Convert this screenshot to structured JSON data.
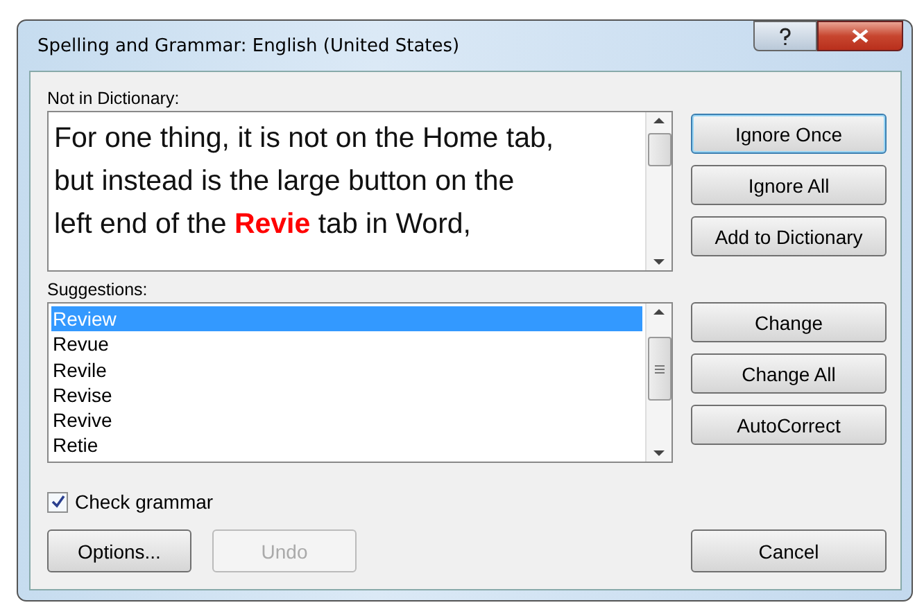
{
  "window": {
    "title": "Spelling and Grammar: English (United States)"
  },
  "not_in_dictionary": {
    "label": "Not in Dictionary:",
    "lines": [
      "For one thing, it is not on the Home tab,",
      "but instead is the large button on the",
      "left end of the **Revie** tab in Word,"
    ]
  },
  "suggestions": {
    "label": "Suggestions:",
    "items": [
      {
        "text": "Review",
        "selected": true
      },
      {
        "text": "Revue",
        "selected": false
      },
      {
        "text": "Revile",
        "selected": false
      },
      {
        "text": "Revise",
        "selected": false
      },
      {
        "text": "Revive",
        "selected": false
      },
      {
        "text": "Retie",
        "selected": false
      }
    ]
  },
  "top_buttons": [
    {
      "label": "Ignore Once",
      "focused": true
    },
    {
      "label": "Ignore All",
      "focused": false
    },
    {
      "label": "Add to Dictionary",
      "focused": false
    }
  ],
  "change_buttons": [
    {
      "label": "Change",
      "focused": false
    },
    {
      "label": "Change All",
      "focused": false
    },
    {
      "label": "AutoCorrect",
      "focused": false
    }
  ],
  "check_grammar": {
    "label": "Check grammar",
    "checked": true
  },
  "bottom_buttons": [
    {
      "label": "Options...",
      "disabled": false
    },
    {
      "label": "Undo",
      "disabled": true
    }
  ],
  "cancel": {
    "label": "Cancel"
  }
}
